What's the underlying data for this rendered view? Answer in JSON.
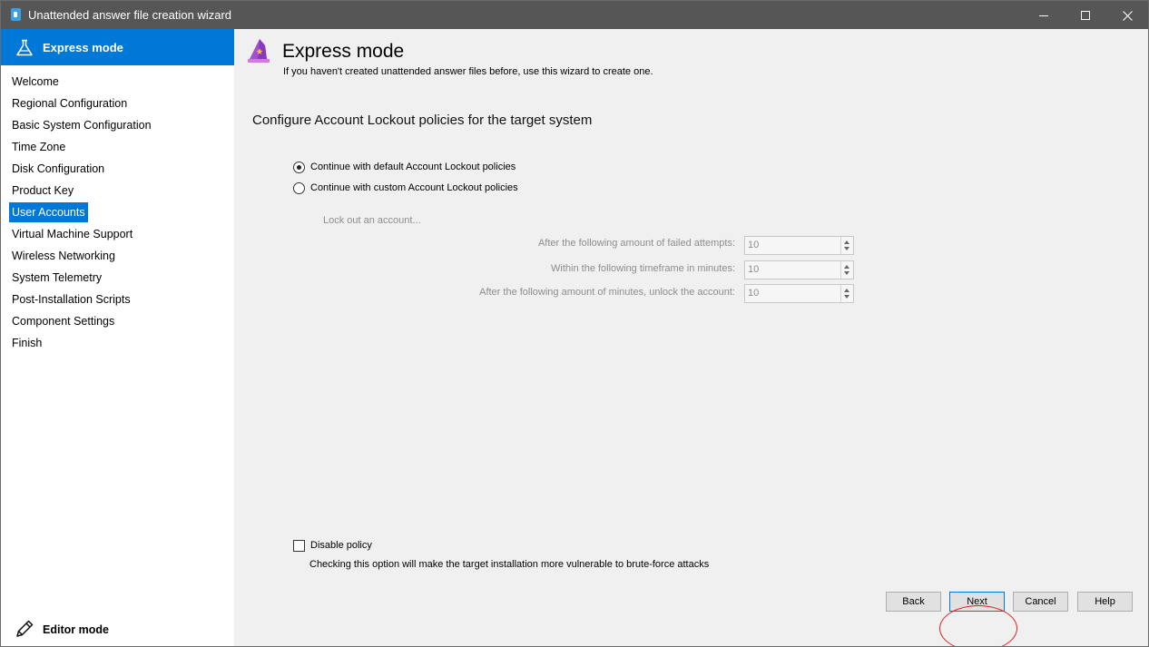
{
  "window": {
    "title": "Unattended answer file creation wizard",
    "controls": {
      "minimize_icon": "minimize-icon",
      "maximize_icon": "maximize-icon",
      "close_icon": "close-icon"
    }
  },
  "sidebar": {
    "mode_header": {
      "label": "Express mode",
      "icon": "flask-icon"
    },
    "items": [
      {
        "label": "Welcome",
        "selected": false
      },
      {
        "label": "Regional Configuration",
        "selected": false
      },
      {
        "label": "Basic System Configuration",
        "selected": false
      },
      {
        "label": "Time Zone",
        "selected": false
      },
      {
        "label": "Disk Configuration",
        "selected": false
      },
      {
        "label": "Product Key",
        "selected": false
      },
      {
        "label": "User Accounts",
        "selected": true
      },
      {
        "label": "Virtual Machine Support",
        "selected": false
      },
      {
        "label": "Wireless Networking",
        "selected": false
      },
      {
        "label": "System Telemetry",
        "selected": false
      },
      {
        "label": "Post-Installation Scripts",
        "selected": false
      },
      {
        "label": "Component Settings",
        "selected": false
      },
      {
        "label": "Finish",
        "selected": false
      }
    ],
    "editor_mode": {
      "label": "Editor mode",
      "icon": "pencil-icon"
    }
  },
  "header": {
    "title": "Express mode",
    "subtitle": "If you haven't created unattended answer files before, use this wizard to create one.",
    "icon": "wizard-hat-icon"
  },
  "content": {
    "section_title": "Configure Account Lockout policies for the target system",
    "radio_default": {
      "label": "Continue with default Account Lockout policies",
      "checked": true
    },
    "radio_custom": {
      "label": "Continue with custom Account Lockout policies",
      "checked": false
    },
    "lock_heading": "Lock out an account...",
    "fields": [
      {
        "label": "After the following amount of failed attempts:",
        "value": "10"
      },
      {
        "label": "Within the following timeframe in minutes:",
        "value": "10"
      },
      {
        "label": "After the following amount of minutes, unlock the account:",
        "value": "10"
      }
    ],
    "disable_policy": {
      "label": "Disable policy",
      "checked": false,
      "description": "Checking this option will make the target installation more vulnerable to brute-force attacks"
    }
  },
  "buttons": {
    "back": "Back",
    "next": "Next",
    "cancel": "Cancel",
    "help": "Help"
  },
  "colors": {
    "accent": "#0078d7",
    "titlebar": "#565656",
    "annotation": "#e01f1f"
  }
}
